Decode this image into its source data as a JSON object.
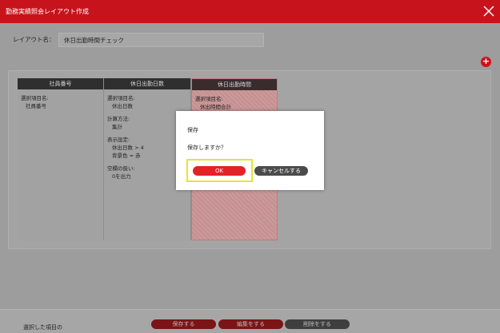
{
  "window": {
    "title": "勤務実績照会レイアウト作成"
  },
  "layout_name": {
    "label": "レイアウト名：",
    "value": "休日出勤時間チェック"
  },
  "columns": [
    {
      "header": "社員番号",
      "lines": [
        "選択項目名:",
        "社員番号"
      ]
    },
    {
      "header": "休日出勤日数",
      "lines": [
        "選択項目名:",
        "休出日数",
        "",
        "計算方法:",
        "集計",
        "",
        "表示設定:",
        "休出日数 > 4",
        "背景色 = 赤",
        "",
        "空欄の扱い:",
        "0を出力"
      ]
    },
    {
      "header": "休日出勤時間",
      "lines": [
        "選択項目名:",
        "休出時間合計"
      ]
    }
  ],
  "dialog": {
    "title": "保存",
    "message": "保存しますか？",
    "ok_label": "OK",
    "cancel_label": "キャンセルする"
  },
  "footer": {
    "selected_label": "選択した項目の",
    "save_label": "保存する",
    "edit_label": "編集をする",
    "delete_label": "削除をする"
  },
  "add_button": "+"
}
